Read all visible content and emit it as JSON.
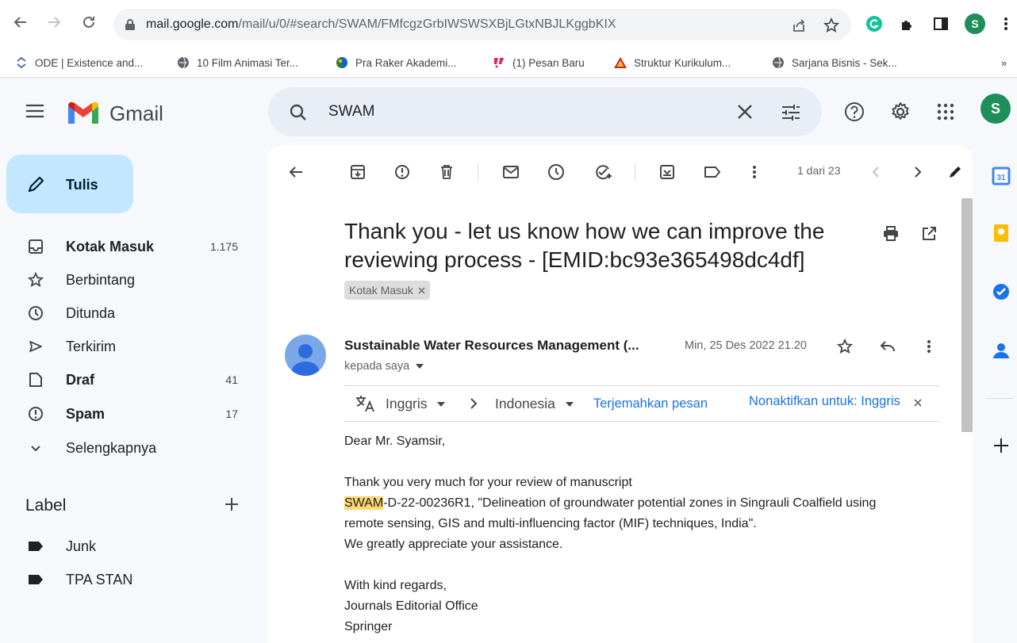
{
  "browser": {
    "url_host": "mail.google.com",
    "url_path": "/mail/u/0/#search/SWAM/FMfcgzGrbIWSWSXBjLGtxNBJLKggbKIX",
    "profile_letter": "S",
    "bookmarks": [
      {
        "label": "ODE | Existence and..."
      },
      {
        "label": "10 Film Animasi Ter..."
      },
      {
        "label": "Pra Raker Akademi..."
      },
      {
        "label": "(1) Pesan Baru"
      },
      {
        "label": "Struktur Kurikulum..."
      },
      {
        "label": "Sarjana Bisnis - Sek..."
      }
    ],
    "more_bookmarks": "»"
  },
  "gmail": {
    "logo_text": "Gmail",
    "search_value": "SWAM",
    "avatar_letter": "S"
  },
  "sidebar": {
    "compose_label": "Tulis",
    "items": [
      {
        "label": "Kotak Masuk",
        "count": "1.175",
        "bold": true,
        "icon": "inbox-icon"
      },
      {
        "label": "Berbintang",
        "count": "",
        "bold": false,
        "icon": "star-icon"
      },
      {
        "label": "Ditunda",
        "count": "",
        "bold": false,
        "icon": "clock-icon"
      },
      {
        "label": "Terkirim",
        "count": "",
        "bold": false,
        "icon": "send-icon"
      },
      {
        "label": "Draf",
        "count": "41",
        "bold": true,
        "icon": "draft-icon"
      },
      {
        "label": "Spam",
        "count": "17",
        "bold": true,
        "icon": "spam-icon"
      },
      {
        "label": "Selengkapnya",
        "count": "",
        "bold": false,
        "icon": "chevron-down-icon"
      }
    ],
    "labels_header": "Label",
    "labels": [
      {
        "label": "Junk"
      },
      {
        "label": "TPA STAN"
      }
    ]
  },
  "toolbar": {
    "pager": "1 dari 23"
  },
  "message": {
    "subject": "Thank you - let us know how we can improve the reviewing process - [EMID:bc93e365498dc4df]",
    "label_chip": "Kotak Masuk",
    "sender": "Sustainable Water Resources Management (...",
    "date": "Min, 25 Des 2022 21.20",
    "to": "kepada saya",
    "translate": {
      "from": "Inggris",
      "to": "Indonesia",
      "action": "Terjemahkan pesan",
      "disable": "Nonaktifkan untuk: Inggris"
    },
    "greeting": "Dear Mr. Syamsir,",
    "line1": "Thank you very much for your review of manuscript",
    "highlight": "SWAM",
    "line2_rest": "-D-22-00236R1, \"Delineation of groundwater potential zones in Singrauli Coalfield using",
    "line3": "remote sensing, GIS and multi-influencing factor (MIF) techniques, India\".",
    "line4": "We greatly appreciate your assistance.",
    "closing1": "With kind regards,",
    "closing2": "Journals Editorial Office",
    "closing3": "Springer"
  },
  "colors": {
    "accent": "#1a73e8",
    "compose_bg": "#c2e7ff",
    "avatar": "#1e8e5a",
    "highlight": "#fcd872"
  }
}
